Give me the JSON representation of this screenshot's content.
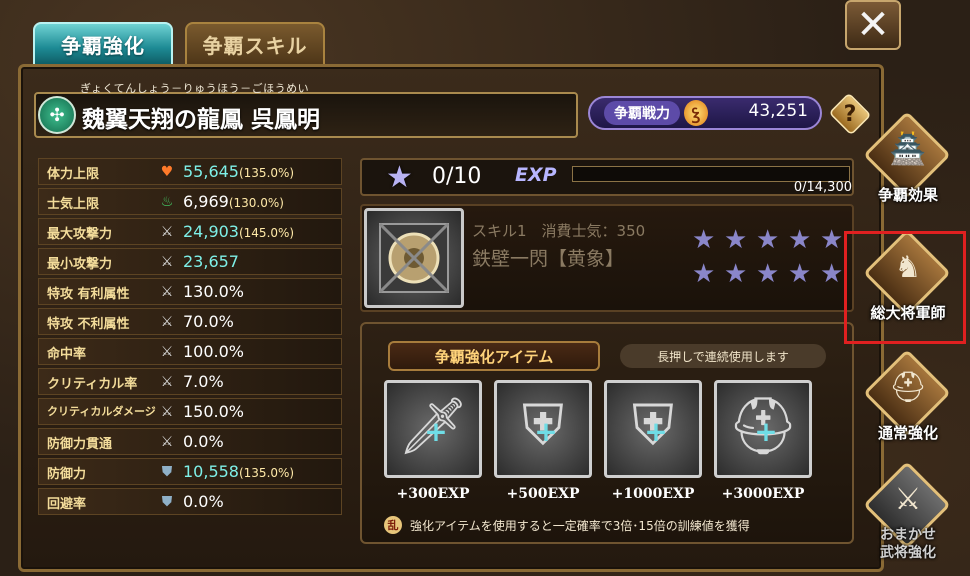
{
  "tabs": [
    {
      "label": "争覇強化",
      "active": true
    },
    {
      "label": "争覇スキル",
      "active": false
    }
  ],
  "general": {
    "ruby": "ぎょくてんしょう－りゅうほう－ごほうめい",
    "name": "魏翼天翔の龍鳳 呉鳳明"
  },
  "power": {
    "label": "争覇戦力",
    "value": "43,251"
  },
  "help_label": "?",
  "close_label": "✕",
  "stats": [
    {
      "label": "体力上限",
      "icon": "heart-icon",
      "glyph": "♥",
      "icon_color": "#ff7a2a",
      "value": "55,645",
      "pct": "(135.0%)",
      "highlight": true
    },
    {
      "label": "士気上限",
      "icon": "flame-icon",
      "glyph": "♨",
      "icon_color": "#45d36a",
      "value": "6,969",
      "pct": "(130.0%)",
      "highlight": false
    },
    {
      "label": "最大攻撃力",
      "icon": "sword-icon",
      "glyph": "⚔",
      "icon_color": "#dcdcdc",
      "value": "24,903",
      "pct": "(145.0%)",
      "highlight": true
    },
    {
      "label": "最小攻撃力",
      "icon": "sword-icon",
      "glyph": "⚔",
      "icon_color": "#dcdcdc",
      "value": "23,657",
      "pct": "",
      "highlight": true
    },
    {
      "label": "特攻 有利属性",
      "icon": "sword-icon",
      "glyph": "⚔",
      "icon_color": "#dcdcdc",
      "value": "130.0%",
      "pct": "",
      "highlight": false
    },
    {
      "label": "特攻 不利属性",
      "icon": "sword-icon",
      "glyph": "⚔",
      "icon_color": "#dcdcdc",
      "value": "70.0%",
      "pct": "",
      "highlight": false
    },
    {
      "label": "命中率",
      "icon": "sword-icon",
      "glyph": "⚔",
      "icon_color": "#dcdcdc",
      "value": "100.0%",
      "pct": "",
      "highlight": false
    },
    {
      "label": "クリティカル率",
      "icon": "sword-icon",
      "glyph": "⚔",
      "icon_color": "#dcdcdc",
      "value": "7.0%",
      "pct": "",
      "highlight": false
    },
    {
      "label": "クリティカルダメージ",
      "icon": "sword-icon",
      "glyph": "⚔",
      "icon_color": "#dcdcdc",
      "value": "150.0%",
      "pct": "",
      "highlight": false
    },
    {
      "label": "防御力貫通",
      "icon": "sword-icon",
      "glyph": "⚔",
      "icon_color": "#dcdcdc",
      "value": "0.0%",
      "pct": "",
      "highlight": false
    },
    {
      "label": "防御力",
      "icon": "shield-icon",
      "glyph": "⛊",
      "icon_color": "#8fb0c8",
      "value": "10,558",
      "pct": "(135.0%)",
      "highlight": true
    },
    {
      "label": "回避率",
      "icon": "shield-icon",
      "glyph": "⛊",
      "icon_color": "#8fb0c8",
      "value": "0.0%",
      "pct": "",
      "highlight": false
    }
  ],
  "exp": {
    "level_text": "0/10",
    "label": "EXP",
    "progress_text": "0/14,300",
    "progress": 0.0
  },
  "skill": {
    "subtitle": "スキル1　消費士気：350",
    "name": "鉄壁一閃【黄象】",
    "stars": [
      "★",
      "★",
      "★",
      "★",
      "★",
      "★",
      "★",
      "★",
      "★",
      "★"
    ]
  },
  "items": {
    "header": "争覇強化アイテム",
    "hint": "長押しで連続使用します",
    "cards": [
      {
        "exp": "+300EXP",
        "glyph": "🗡"
      },
      {
        "exp": "+500EXP",
        "glyph": "⛨"
      },
      {
        "exp": "+1000EXP",
        "glyph": "⛨"
      },
      {
        "exp": "+3000EXP",
        "glyph": "⛑"
      }
    ],
    "note_badge": "乱",
    "note": "強化アイテムを使用すると一定確率で3倍･15倍の訓練値を獲得"
  },
  "side_buttons": [
    {
      "label": "争覇効果",
      "glyph": "🏯",
      "dim": false
    },
    {
      "label": "総大将軍師",
      "glyph": "♞",
      "dim": false
    },
    {
      "label": "通常強化",
      "glyph": "⛑",
      "dim": false
    },
    {
      "label": "おまかせ\n武将強化",
      "glyph": "⚔",
      "dim": true
    }
  ],
  "colors": {
    "accent_teal": "#1d8a94",
    "frame_gold": "#8a6a35",
    "highlight_red": "#e02020"
  }
}
